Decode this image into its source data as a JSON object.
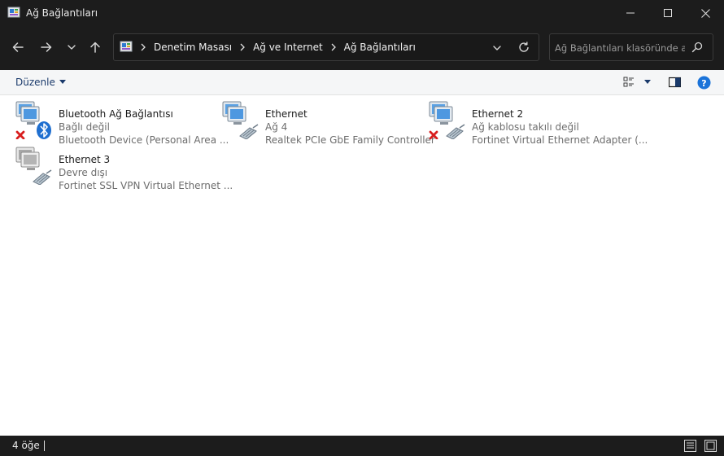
{
  "window": {
    "title": "Ağ Bağlantıları"
  },
  "address": {
    "breadcrumbs": [
      "Denetim Masası",
      "Ağ ve Internet",
      "Ağ Bağlantıları"
    ]
  },
  "search": {
    "placeholder": "Ağ Bağlantıları klasöründe ara"
  },
  "toolbar": {
    "organize_label": "Düzenle"
  },
  "connections": [
    {
      "name": "Bluetooth Ağ Bağlantısı",
      "status": "Bağlı değil",
      "device": "Bluetooth Device (Personal Area ...",
      "icon": "bluetooth-network-icon",
      "disconnected": true
    },
    {
      "name": "Ethernet",
      "status": "Ağ 4",
      "device": "Realtek PCIe GbE Family Controller",
      "icon": "ethernet-network-icon",
      "disconnected": false
    },
    {
      "name": "Ethernet 2",
      "status": "Ağ kablosu takılı değil",
      "device": "Fortinet Virtual Ethernet Adapter (...",
      "icon": "ethernet-network-icon",
      "disconnected": true
    },
    {
      "name": "Ethernet 3",
      "status": "Devre dışı",
      "device": "Fortinet SSL VPN Virtual Ethernet ...",
      "icon": "ethernet-network-disabled-icon",
      "disconnected": false
    }
  ],
  "status_bar": {
    "item_count": "4 öğe"
  },
  "colors": {
    "chrome": "#1c1c1c",
    "content_bg": "#ffffff",
    "command_bar": "#f5f6f7",
    "error_red": "#d81e1e",
    "bluetooth_blue": "#1f6fd0",
    "help_blue": "#1a73d9"
  }
}
